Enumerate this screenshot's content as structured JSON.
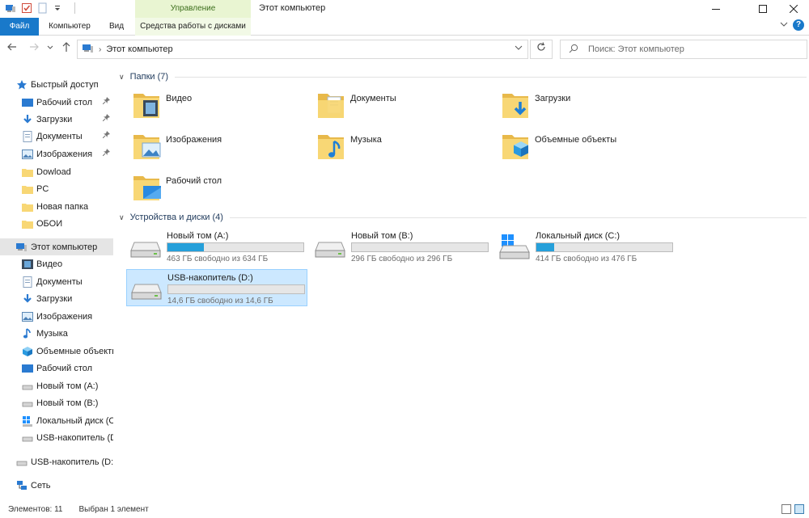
{
  "titlebar": {
    "context_tab": "Управление",
    "window_title": "Этот компьютер"
  },
  "ribbon": {
    "tabs": [
      "Файл",
      "Компьютер",
      "Вид",
      "Средства работы с дисками"
    ]
  },
  "address": {
    "breadcrumb": "Этот компьютер"
  },
  "search": {
    "placeholder": "Поиск: Этот компьютер"
  },
  "sidebar": {
    "quick_access": {
      "label": "Быстрый доступ",
      "items": [
        "Рабочий стол",
        "Загрузки",
        "Документы",
        "Изображения",
        "Dowload",
        "PC",
        "Новая папка",
        "ОБОИ"
      ]
    },
    "this_pc": {
      "label": "Этот компьютер",
      "items": [
        "Видео",
        "Документы",
        "Загрузки",
        "Изображения",
        "Музыка",
        "Объемные объекты",
        "Рабочий стол",
        "Новый том (A:)",
        "Новый том (B:)",
        "Локальный диск (C:)",
        "USB-накопитель (D:)"
      ]
    },
    "usb_root": "USB-накопитель (D:)",
    "network": "Сеть"
  },
  "main": {
    "folders_header": "Папки (7)",
    "folders": [
      "Видео",
      "Документы",
      "Загрузки",
      "Изображения",
      "Музыка",
      "Объемные объекты",
      "Рабочий стол"
    ],
    "drives_header": "Устройства и диски (4)",
    "drives": [
      {
        "name": "Новый том (A:)",
        "free": "463 ГБ свободно из 634 ГБ",
        "used_fraction": 0.27
      },
      {
        "name": "Новый том (B:)",
        "free": "296 ГБ свободно из 296 ГБ",
        "used_fraction": 0.0
      },
      {
        "name": "Локальный диск (C:)",
        "free": "414 ГБ свободно из 476 ГБ",
        "used_fraction": 0.13
      },
      {
        "name": "USB-накопитель (D:)",
        "free": "14,6 ГБ свободно из 14,6 ГБ",
        "used_fraction": 0.0
      }
    ]
  },
  "status": {
    "count": "Элементов: 11",
    "selection": "Выбран 1 элемент"
  },
  "colors": {
    "accent": "#1979ca",
    "folder": "#f8d775",
    "progress": "#26a0da",
    "selection": "#cce8ff"
  }
}
